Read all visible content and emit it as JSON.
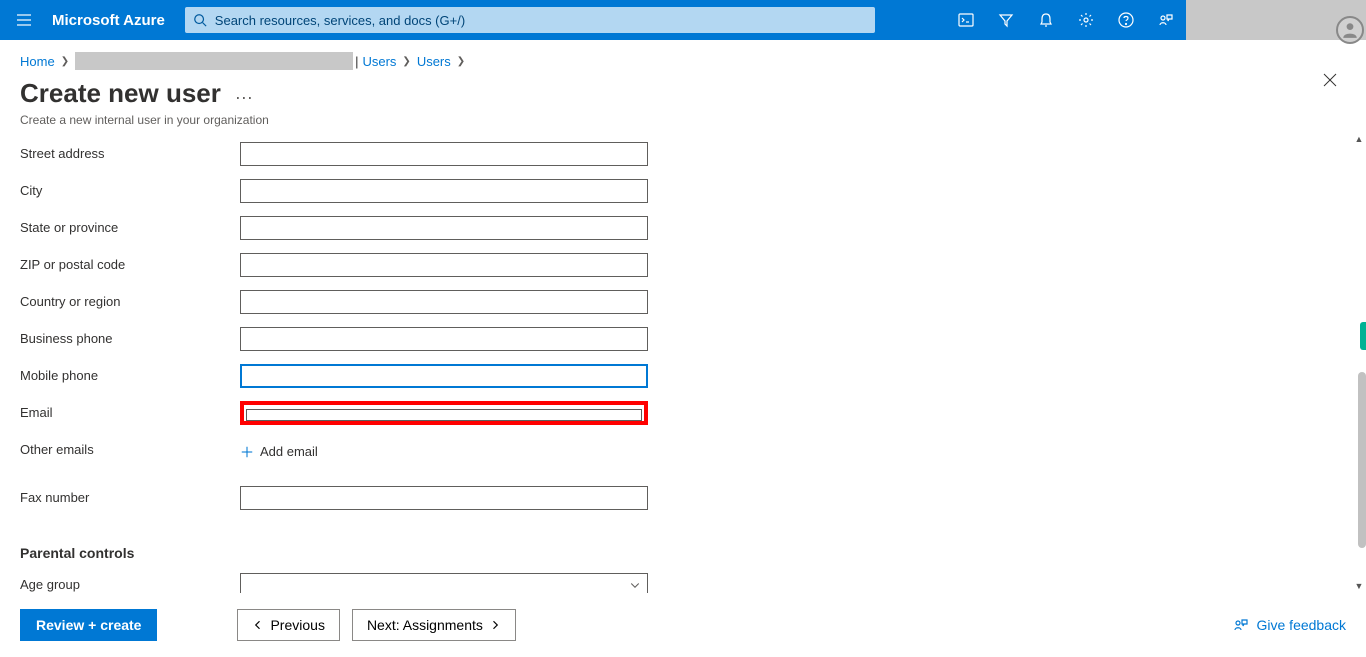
{
  "topbar": {
    "brand": "Microsoft Azure",
    "search_placeholder": "Search resources, services, and docs (G+/)"
  },
  "breadcrumb": {
    "home": "Home",
    "users1": "Users",
    "users2": "Users"
  },
  "page": {
    "title": "Create new user",
    "subtitle": "Create a new internal user in your organization"
  },
  "fields": {
    "street_address": "Street address",
    "city": "City",
    "state": "State or province",
    "zip": "ZIP or postal code",
    "country": "Country or region",
    "business_phone": "Business phone",
    "mobile_phone": "Mobile phone",
    "email": "Email",
    "other_emails": "Other emails",
    "add_email": "Add email",
    "fax": "Fax number",
    "parental": "Parental controls",
    "age_group": "Age group"
  },
  "footer": {
    "review": "Review + create",
    "previous": "Previous",
    "next": "Next: Assignments",
    "feedback": "Give feedback"
  }
}
